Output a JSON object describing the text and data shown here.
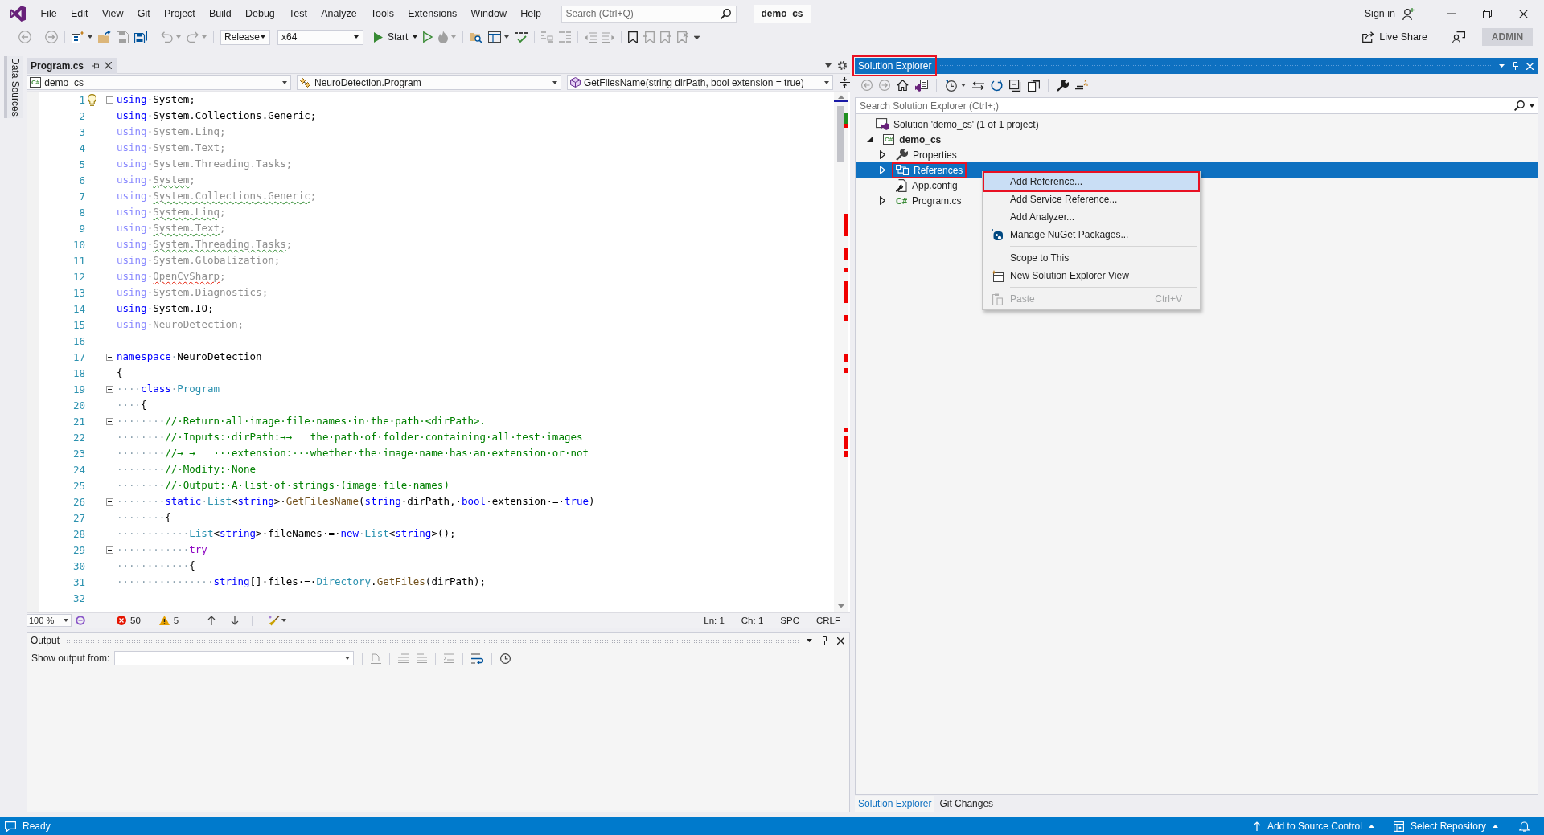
{
  "menu_bar": {
    "items": [
      "File",
      "Edit",
      "View",
      "Git",
      "Project",
      "Build",
      "Debug",
      "Test",
      "Analyze",
      "Tools",
      "Extensions",
      "Window",
      "Help"
    ],
    "search": {
      "placeholder": "Search (Ctrl+Q)"
    },
    "solution_name": "demo_cs",
    "sign_in": "Sign in"
  },
  "toolbar": {
    "configuration": "Release",
    "platform": "x64",
    "start": "Start",
    "live_share": "Live Share",
    "account": "ADMIN"
  },
  "side_tab": "Data Sources",
  "editor": {
    "tabs": [
      {
        "label": "Program.cs",
        "selected": true
      }
    ],
    "navigation": {
      "project": {
        "tag": "C#",
        "label": "demo_cs"
      },
      "type": "NeuroDetection.Program",
      "member": "GetFilesName(string dirPath, bool extension = true)"
    },
    "lines": [
      {
        "number": "1",
        "fold": true,
        "bulb": true,
        "faded": false,
        "warning": false,
        "error": false,
        "segments": [
          {
            "text": "using",
            "kind": "keyword"
          },
          {
            "text": "·",
            "kind": "ws"
          },
          {
            "text": "System",
            "kind": "ns"
          },
          {
            "text": ";",
            "kind": "plain"
          }
        ]
      },
      {
        "number": "2",
        "fold": false,
        "bulb": false,
        "faded": false,
        "warning": false,
        "error": false,
        "segments": [
          {
            "text": "using",
            "kind": "keyword"
          },
          {
            "text": "·",
            "kind": "ws"
          },
          {
            "text": "System.Collections.Generic",
            "kind": "ns"
          },
          {
            "text": ";",
            "kind": "plain"
          }
        ]
      },
      {
        "number": "3",
        "fold": false,
        "bulb": false,
        "faded": true,
        "warning": false,
        "error": false,
        "segments": [
          {
            "text": "using",
            "kind": "keyword"
          },
          {
            "text": "·",
            "kind": "ws"
          },
          {
            "text": "System.Linq",
            "kind": "ns"
          },
          {
            "text": ";",
            "kind": "plain"
          }
        ]
      },
      {
        "number": "4",
        "fold": false,
        "bulb": false,
        "faded": true,
        "warning": false,
        "error": false,
        "segments": [
          {
            "text": "using",
            "kind": "keyword"
          },
          {
            "text": "·",
            "kind": "ws"
          },
          {
            "text": "System.Text",
            "kind": "ns"
          },
          {
            "text": ";",
            "kind": "plain"
          }
        ]
      },
      {
        "number": "5",
        "fold": false,
        "bulb": false,
        "faded": true,
        "warning": false,
        "error": false,
        "segments": [
          {
            "text": "using",
            "kind": "keyword"
          },
          {
            "text": "·",
            "kind": "ws"
          },
          {
            "text": "System.Threading.Tasks",
            "kind": "ns"
          },
          {
            "text": ";",
            "kind": "plain"
          }
        ]
      },
      {
        "number": "6",
        "fold": false,
        "bulb": false,
        "faded": true,
        "warning": true,
        "error": false,
        "segments": [
          {
            "text": "using",
            "kind": "keyword"
          },
          {
            "text": "·",
            "kind": "ws"
          },
          {
            "text": "System",
            "kind": "ns"
          },
          {
            "text": ";",
            "kind": "plain"
          }
        ]
      },
      {
        "number": "7",
        "fold": false,
        "bulb": false,
        "faded": true,
        "warning": true,
        "error": false,
        "segments": [
          {
            "text": "using",
            "kind": "keyword"
          },
          {
            "text": "·",
            "kind": "ws"
          },
          {
            "text": "System.Collections.Generic",
            "kind": "ns"
          },
          {
            "text": ";",
            "kind": "plain"
          }
        ]
      },
      {
        "number": "8",
        "fold": false,
        "bulb": false,
        "faded": true,
        "warning": true,
        "error": false,
        "segments": [
          {
            "text": "using",
            "kind": "keyword"
          },
          {
            "text": "·",
            "kind": "ws"
          },
          {
            "text": "System.Linq",
            "kind": "ns"
          },
          {
            "text": ";",
            "kind": "plain"
          }
        ]
      },
      {
        "number": "9",
        "fold": false,
        "bulb": false,
        "faded": true,
        "warning": true,
        "error": false,
        "segments": [
          {
            "text": "using",
            "kind": "keyword"
          },
          {
            "text": "·",
            "kind": "ws"
          },
          {
            "text": "System.Text",
            "kind": "ns"
          },
          {
            "text": ";",
            "kind": "plain"
          }
        ]
      },
      {
        "number": "10",
        "fold": false,
        "bulb": false,
        "faded": true,
        "warning": true,
        "error": false,
        "segments": [
          {
            "text": "using",
            "kind": "keyword"
          },
          {
            "text": "·",
            "kind": "ws"
          },
          {
            "text": "System.Threading.Tasks",
            "kind": "ns"
          },
          {
            "text": ";",
            "kind": "plain"
          }
        ]
      },
      {
        "number": "11",
        "fold": false,
        "bulb": false,
        "faded": true,
        "warning": false,
        "error": false,
        "segments": [
          {
            "text": "using",
            "kind": "keyword"
          },
          {
            "text": "·",
            "kind": "ws"
          },
          {
            "text": "System.Globalization",
            "kind": "ns"
          },
          {
            "text": ";",
            "kind": "plain"
          }
        ]
      },
      {
        "number": "12",
        "fold": false,
        "bulb": false,
        "faded": true,
        "warning": false,
        "error": true,
        "segments": [
          {
            "text": "using",
            "kind": "keyword"
          },
          {
            "text": "·",
            "kind": "ws"
          },
          {
            "text": "OpenCvSharp",
            "kind": "ns"
          },
          {
            "text": ";",
            "kind": "plain"
          }
        ]
      },
      {
        "number": "13",
        "fold": false,
        "bulb": false,
        "faded": true,
        "warning": false,
        "error": false,
        "segments": [
          {
            "text": "using",
            "kind": "keyword"
          },
          {
            "text": "·",
            "kind": "ws"
          },
          {
            "text": "System.Diagnostics",
            "kind": "ns"
          },
          {
            "text": ";",
            "kind": "plain"
          }
        ]
      },
      {
        "number": "14",
        "fold": false,
        "bulb": false,
        "faded": false,
        "warning": false,
        "error": false,
        "segments": [
          {
            "text": "using",
            "kind": "keyword"
          },
          {
            "text": "·",
            "kind": "ws"
          },
          {
            "text": "System.IO",
            "kind": "ns"
          },
          {
            "text": ";",
            "kind": "plain"
          }
        ]
      },
      {
        "number": "15",
        "fold": false,
        "bulb": false,
        "faded": true,
        "warning": false,
        "error": false,
        "segments": [
          {
            "text": "using",
            "kind": "keyword"
          },
          {
            "text": "·",
            "kind": "ws"
          },
          {
            "text": "NeuroDetection",
            "kind": "ns"
          },
          {
            "text": ";",
            "kind": "plain"
          }
        ]
      },
      {
        "number": "16",
        "fold": false,
        "bulb": false
      },
      {
        "number": "17",
        "fold": true,
        "bulb": false,
        "faded": false,
        "warning": false,
        "error": false,
        "segments": [
          {
            "text": "namespace",
            "kind": "keyword"
          },
          {
            "text": "·",
            "kind": "ws"
          },
          {
            "text": "NeuroDetection",
            "kind": "plain"
          }
        ]
      },
      {
        "number": "18",
        "fold": false,
        "bulb": false,
        "faded": false,
        "warning": false,
        "error": false,
        "segments": [
          {
            "text": "{",
            "kind": "plain"
          }
        ]
      },
      {
        "number": "19",
        "fold": true,
        "bulb": false,
        "faded": false,
        "warning": false,
        "error": false,
        "segments": [
          {
            "text": "····",
            "kind": "ws"
          },
          {
            "text": "class",
            "kind": "keyword"
          },
          {
            "text": "·",
            "kind": "ws"
          },
          {
            "text": "Program",
            "kind": "type"
          }
        ]
      },
      {
        "number": "20",
        "fold": false,
        "bulb": false,
        "faded": false,
        "warning": false,
        "error": false,
        "segments": [
          {
            "text": "····",
            "kind": "ws"
          },
          {
            "text": "{",
            "kind": "plain"
          }
        ]
      },
      {
        "number": "21",
        "fold": true,
        "bulb": false,
        "faded": false,
        "warning": false,
        "error": false,
        "segments": [
          {
            "text": "········",
            "kind": "ws"
          },
          {
            "text": "//·Return·all·image·file·names·in·the·path·<dirPath>.",
            "kind": "comment"
          }
        ]
      },
      {
        "number": "22",
        "fold": false,
        "bulb": false,
        "faded": false,
        "warning": false,
        "error": false,
        "segments": [
          {
            "text": "········",
            "kind": "ws"
          },
          {
            "text": "//·Inputs:·dirPath:→→   the·path·of·folder·containing·all·test·images",
            "kind": "comment"
          }
        ]
      },
      {
        "number": "23",
        "fold": false,
        "bulb": false,
        "faded": false,
        "warning": false,
        "error": false,
        "segments": [
          {
            "text": "········",
            "kind": "ws"
          },
          {
            "text": "//→ →   ···extension:···whether·the·image·name·has·an·extension·or·not",
            "kind": "comment"
          }
        ]
      },
      {
        "number": "24",
        "fold": false,
        "bulb": false,
        "faded": false,
        "warning": false,
        "error": false,
        "segments": [
          {
            "text": "········",
            "kind": "ws"
          },
          {
            "text": "//·Modify:·None",
            "kind": "comment"
          }
        ]
      },
      {
        "number": "25",
        "fold": false,
        "bulb": false,
        "faded": false,
        "warning": false,
        "error": false,
        "segments": [
          {
            "text": "········",
            "kind": "ws"
          },
          {
            "text": "//·Output:·A·list·of·strings·(image·file·names)",
            "kind": "comment"
          }
        ]
      },
      {
        "number": "26",
        "fold": true,
        "bulb": false,
        "faded": false,
        "warning": false,
        "error": false,
        "segments": [
          {
            "text": "········",
            "kind": "ws"
          },
          {
            "text": "static",
            "kind": "keyword"
          },
          {
            "text": "·",
            "kind": "ws"
          },
          {
            "text": "List",
            "kind": "type"
          },
          {
            "text": "<",
            "kind": "plain"
          },
          {
            "text": "string",
            "kind": "keyword"
          },
          {
            "text": ">·",
            "kind": "plain"
          },
          {
            "text": "GetFilesName",
            "kind": "method"
          },
          {
            "text": "(",
            "kind": "plain"
          },
          {
            "text": "string",
            "kind": "keyword"
          },
          {
            "text": "·dirPath,·",
            "kind": "plain"
          },
          {
            "text": "bool",
            "kind": "keyword"
          },
          {
            "text": "·extension·=·",
            "kind": "plain"
          },
          {
            "text": "true",
            "kind": "keyword"
          },
          {
            "text": ")",
            "kind": "plain"
          }
        ]
      },
      {
        "number": "27",
        "fold": false,
        "bulb": false,
        "faded": false,
        "warning": false,
        "error": false,
        "segments": [
          {
            "text": "········",
            "kind": "ws"
          },
          {
            "text": "{",
            "kind": "plain"
          }
        ]
      },
      {
        "number": "28",
        "fold": false,
        "bulb": false,
        "faded": false,
        "warning": false,
        "error": false,
        "segments": [
          {
            "text": "············",
            "kind": "ws"
          },
          {
            "text": "List",
            "kind": "type"
          },
          {
            "text": "<",
            "kind": "plain"
          },
          {
            "text": "string",
            "kind": "keyword"
          },
          {
            "text": ">·fileNames·=·",
            "kind": "plain"
          },
          {
            "text": "new",
            "kind": "keyword"
          },
          {
            "text": "·",
            "kind": "ws"
          },
          {
            "text": "List",
            "kind": "type"
          },
          {
            "text": "<",
            "kind": "plain"
          },
          {
            "text": "string",
            "kind": "keyword"
          },
          {
            "text": ">();",
            "kind": "plain"
          }
        ]
      },
      {
        "number": "29",
        "fold": true,
        "bulb": false,
        "faded": false,
        "warning": false,
        "error": false,
        "segments": [
          {
            "text": "············",
            "kind": "ws"
          },
          {
            "text": "try",
            "kind": "control"
          }
        ]
      },
      {
        "number": "30",
        "fold": false,
        "bulb": false,
        "faded": false,
        "warning": false,
        "error": false,
        "segments": [
          {
            "text": "············",
            "kind": "ws"
          },
          {
            "text": "{",
            "kind": "plain"
          }
        ]
      },
      {
        "number": "31",
        "fold": false,
        "bulb": false,
        "faded": false,
        "warning": false,
        "error": false,
        "segments": [
          {
            "text": "················",
            "kind": "ws"
          },
          {
            "text": "string",
            "kind": "keyword"
          },
          {
            "text": "[]·files·=·",
            "kind": "plain"
          },
          {
            "text": "Directory",
            "kind": "type"
          },
          {
            "text": ".",
            "kind": "plain"
          },
          {
            "text": "GetFiles",
            "kind": "method"
          },
          {
            "text": "(dirPath);",
            "kind": "plain"
          }
        ]
      },
      {
        "number": "32",
        "fold": false,
        "bulb": false
      }
    ],
    "status": {
      "zoom": "100 %",
      "errors": "50",
      "warnings": "5",
      "line": "Ln: 1",
      "column": "Ch: 1",
      "whitespace": "SPC",
      "line_ending": "CRLF"
    }
  },
  "output": {
    "title": "Output",
    "source_label": "Show output from:"
  },
  "solution_explorer": {
    "title": "Solution Explorer",
    "title_marked": true,
    "search": {
      "placeholder": "Search Solution Explorer (Ctrl+;)"
    },
    "tree": [
      {
        "label": "Solution 'demo_cs' (1 of 1 project)",
        "kind": "solution",
        "selected": false,
        "marked": false,
        "children": [
          {
            "label": "demo_cs",
            "kind": "project",
            "tag": "C#",
            "expanded": true,
            "selected": false,
            "marked": false,
            "children": [
              {
                "label": "Properties",
                "kind": "properties",
                "expanded": false,
                "selected": false,
                "marked": false
              },
              {
                "label": "References",
                "kind": "references",
                "expanded": false,
                "selected": true,
                "marked": true
              },
              {
                "label": "App.config",
                "kind": "config",
                "selected": false,
                "marked": false
              },
              {
                "label": "Program.cs",
                "kind": "file",
                "tag": "C#",
                "expanded": false,
                "selected": false,
                "marked": false
              }
            ]
          }
        ]
      }
    ],
    "context_menu": {
      "groups": [
        [
          {
            "label": "Add Reference...",
            "kind": "plain",
            "selected": true,
            "disabled": false,
            "marked": true
          },
          {
            "label": "Add Service Reference...",
            "kind": "plain",
            "selected": false,
            "disabled": false,
            "marked": false
          },
          {
            "label": "Add Analyzer...",
            "kind": "plain",
            "selected": false,
            "disabled": false,
            "marked": false
          },
          {
            "label": "Manage NuGet Packages...",
            "kind": "package",
            "selected": false,
            "disabled": false,
            "marked": false
          }
        ],
        [
          {
            "label": "Scope to This",
            "kind": "plain",
            "selected": false,
            "disabled": false,
            "marked": false
          },
          {
            "label": "New Solution Explorer View",
            "kind": "window",
            "selected": false,
            "disabled": false,
            "marked": false
          }
        ],
        [
          {
            "label": "Paste",
            "kind": "clipboard",
            "shortcut": "Ctrl+V",
            "selected": false,
            "disabled": true,
            "marked": false
          }
        ]
      ]
    },
    "bottom_tabs": [
      {
        "label": "Solution Explorer",
        "selected": true
      },
      {
        "label": "Git Changes",
        "selected": false
      }
    ]
  },
  "status_bar": {
    "message": "Ready",
    "source_control": "Add to Source Control",
    "repository": "Select Repository"
  }
}
